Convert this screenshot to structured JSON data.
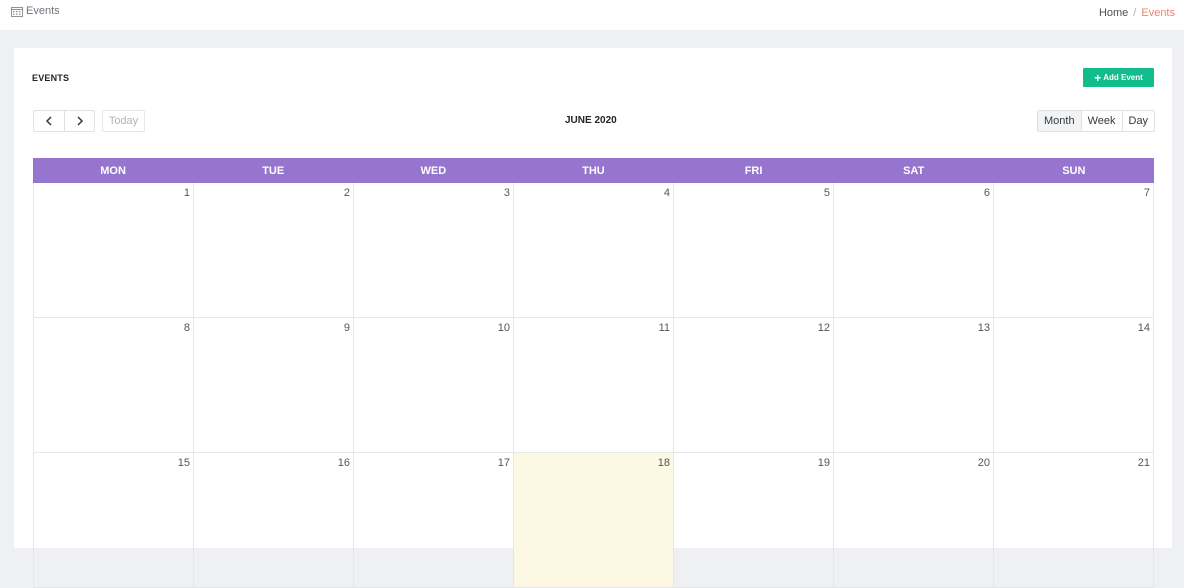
{
  "topbar": {
    "page_label": "Events",
    "page_icon": "calendar-icon",
    "breadcrumb": {
      "home": "Home",
      "separator": "/",
      "current": "Events"
    }
  },
  "card": {
    "title": "EVENTS",
    "add_button": {
      "icon": "plus-icon",
      "label": "Add Event"
    }
  },
  "toolbar": {
    "prev_icon": "chevron-left-icon",
    "next_icon": "chevron-right-icon",
    "today_label": "Today",
    "title": "JUNE 2020",
    "views": [
      "Month",
      "Week",
      "Day"
    ],
    "active_view": "Month"
  },
  "calendar": {
    "weekdays": [
      "MON",
      "TUE",
      "WED",
      "THU",
      "FRI",
      "SAT",
      "SUN"
    ],
    "weeks": [
      [
        "1",
        "2",
        "3",
        "4",
        "5",
        "6",
        "7"
      ],
      [
        "8",
        "9",
        "10",
        "11",
        "12",
        "13",
        "14"
      ],
      [
        "15",
        "16",
        "17",
        "18",
        "19",
        "20",
        "21"
      ]
    ],
    "highlighted_day": "18"
  },
  "colors": {
    "header_bg": "#9575cd",
    "add_button_bg": "#13bc8b",
    "breadcrumb_active": "#f1836e",
    "today_cell_bg": "#fcf8e3"
  }
}
